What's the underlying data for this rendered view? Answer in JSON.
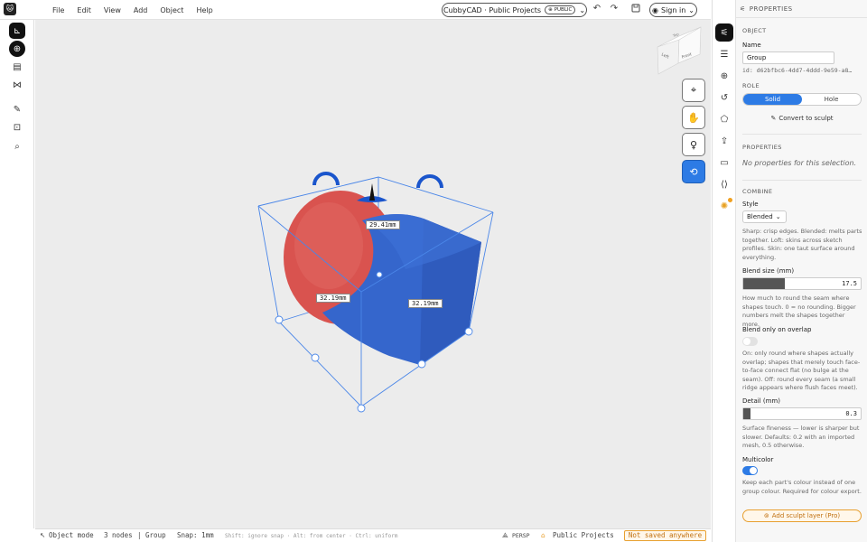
{
  "app": {
    "logo_glyph": "🐱"
  },
  "menu": [
    "File",
    "Edit",
    "View",
    "Add",
    "Object",
    "Help"
  ],
  "project": {
    "title": "CubbyCAD · Public Projects",
    "badge": "PUBLIC"
  },
  "signin": {
    "label": "Sign in"
  },
  "viewport": {
    "dimensions": [
      "29.41mm",
      "32.19mm",
      "32.19mm"
    ],
    "viewcube": {
      "top": "Top",
      "front": "Front",
      "left": "Left"
    }
  },
  "status": {
    "mode": "Object mode",
    "nodes": "3 nodes",
    "group": "| Group",
    "snap": "Snap: 1mm",
    "hint": "Shift: ignore snap · Alt: from center · Ctrl: uniform",
    "projection": "PERSP",
    "project": "Public Projects",
    "saved": "Not saved anywhere"
  },
  "panel": {
    "title": "PROPERTIES",
    "object_section": "OBJECT",
    "name_label": "Name",
    "name_value": "Group",
    "id": "id: d62bfbc6-4dd7-4ddd-9e59-a8…",
    "role_section": "ROLE",
    "role_solid": "Solid",
    "role_hole": "Hole",
    "convert": "Convert to sculpt",
    "props_section": "PROPERTIES",
    "no_props": "No properties for this selection.",
    "combine_section": "COMBINE",
    "style_label": "Style",
    "style_value": "Blended",
    "style_desc": "Sharp: crisp edges. Blended: melts parts together. Loft: skins across sketch profiles. Skin: one taut surface around everything.",
    "blend_label": "Blend size (mm)",
    "blend_value": "17.5",
    "blend_fraction": 0.35,
    "blend_desc": "How much to round the seam where shapes touch. 0 = no rounding. Bigger numbers melt the shapes together more.",
    "overlap_label": "Blend only on overlap",
    "overlap_on": false,
    "overlap_desc": "On: only round where shapes actually overlap; shapes that merely touch face-to-face connect flat (no bulge at the seam). Off: round every seam (a small ridge appears where flush faces meet).",
    "detail_label": "Detail (mm)",
    "detail_value": "0.3",
    "detail_fraction": 0.06,
    "detail_desc": "Surface fineness — lower is sharper but slower. Defaults: 0.2 with an imported mesh, 0.5 otherwise.",
    "multicolor_label": "Multicolor",
    "multicolor_on": true,
    "multicolor_desc": "Keep each part's colour instead of one group colour. Required for colour export.",
    "add_layer": "Add sculpt layer (Pro)"
  },
  "colors": {
    "accent": "#2d7be5",
    "warning": "#e8a030",
    "shape_red": "#d9534f",
    "shape_blue": "#3566cc"
  }
}
